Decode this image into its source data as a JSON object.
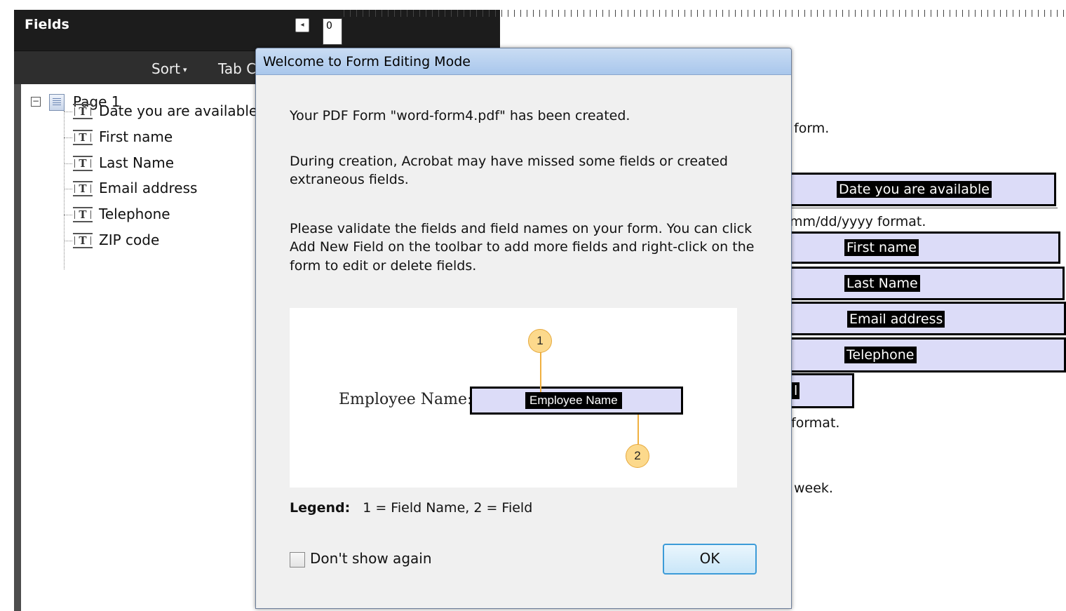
{
  "fields_panel": {
    "title": "Fields",
    "collapse_icon": "◂",
    "toolbar": {
      "sort_label": "Sort",
      "sort_caret": "▾",
      "tab_label": "Tab C"
    },
    "tree": {
      "expander": "−",
      "page_label": "Page 1",
      "field_icon_glyph": "T",
      "items": [
        "Date you are available",
        "First name",
        "Last Name",
        "Email address",
        "Telephone",
        "ZIP code"
      ]
    }
  },
  "document": {
    "ruler_value": "0",
    "texts": {
      "form": "form.",
      "date_format": "mm/dd/yyyy format.",
      "format2": "format.",
      "week": "week."
    },
    "fields": [
      "Date you are available",
      "First name",
      "Last Name",
      "Email address",
      "Telephone"
    ],
    "zip_partial": "l"
  },
  "dialog": {
    "title": "Welcome to Form Editing Mode",
    "para1": "Your PDF Form \"word-form4.pdf\" has been created.",
    "para2_line1": "During creation, Acrobat may have missed some fields or created",
    "para2_line2": "extraneous fields.",
    "para3_line1": "Please validate the fields and field names on your form. You can click",
    "para3_line2": "Add New Field on the toolbar to add more fields and right-click on the",
    "para3_line3": "form to edit or delete fields.",
    "illustration": {
      "label": "Employee Name:",
      "field_name": "Employee Name",
      "callout1": "1",
      "callout2": "2"
    },
    "legend_label": "Legend:",
    "legend_text": "1 = Field Name, 2 = Field",
    "dont_show_label": "Don't show again",
    "dont_show_checked": false,
    "ok_label": "OK"
  }
}
